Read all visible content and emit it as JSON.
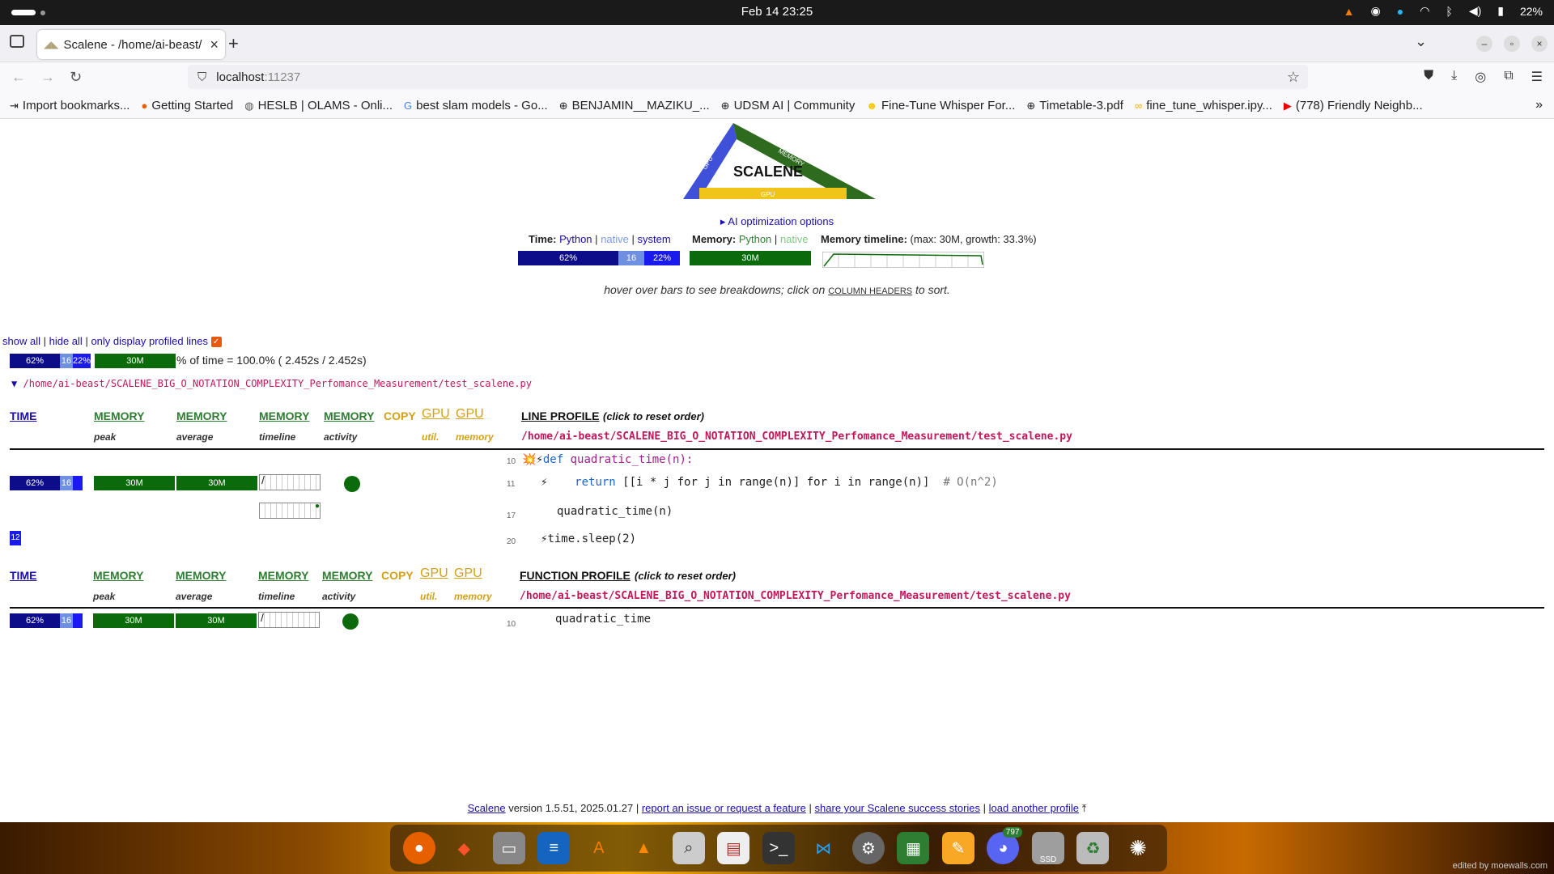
{
  "system": {
    "clock": "Feb 14  23:25",
    "battery": "22%"
  },
  "browser": {
    "tab_title": "Scalene - /home/ai-beast/",
    "url_host": "localhost",
    "url_port": ":11237",
    "bookmarks": [
      {
        "label": "Import bookmarks...",
        "icon": "import-icon"
      },
      {
        "label": "Getting Started",
        "icon": "firefox-icon"
      },
      {
        "label": "HESLB | OLAMS - Onli...",
        "icon": "heslb-icon"
      },
      {
        "label": "best slam models - Go...",
        "icon": "google-icon"
      },
      {
        "label": "BENJAMIN__MAZIKU_...",
        "icon": "globe-icon"
      },
      {
        "label": "UDSM AI | Community",
        "icon": "globe-icon"
      },
      {
        "label": "Fine-Tune Whisper For...",
        "icon": "hf-icon"
      },
      {
        "label": "Timetable-3.pdf",
        "icon": "globe-icon"
      },
      {
        "label": "fine_tune_whisper.ipy...",
        "icon": "colab-icon"
      },
      {
        "label": "(778) Friendly Neighb...",
        "icon": "youtube-icon"
      }
    ]
  },
  "scalene": {
    "logo_text": "SCALENE",
    "logo_gpu_left": "GPU",
    "logo_memory": "MEMORY",
    "logo_gpu_bottom": "GPU",
    "ai_options": "▸ AI optimization options",
    "time_label": "Time:",
    "time_python": "Python",
    "time_native": "native",
    "time_system": "system",
    "sep": "|",
    "memory_label": "Memory:",
    "memory_python": "Python",
    "memory_native": "native",
    "memtimeline_label": "Memory timeline:",
    "memtimeline_detail": "(max: 30M, growth: 33.3%)",
    "bar_python_pct": "62%",
    "bar_native_pct": "16",
    "bar_system_pct": "22%",
    "bar_memory": "30M",
    "time_python_frac": 0.62,
    "time_native_frac": 0.16,
    "time_system_frac": 0.22,
    "hint_pre": "hover over bars to see breakdowns; click on",
    "hint_headers": "COLUMN HEADERS",
    "hint_post": "to sort.",
    "show_all": "show all",
    "hide_all": "hide all",
    "only_profiled": "only display profiled lines",
    "check_mark": "✓",
    "summary_pct_text": "% of time = 100.0% ( 2.452s / 2.452s)",
    "summary_python": "62%",
    "summary_native": "16",
    "summary_system": "22%",
    "summary_mem": "30M",
    "file_toggle": "▼",
    "file_path": "/home/ai-beast/SCALENE_BIG_O_NOTATION_COMPLEXITY_Perfomance_Measurement/test_scalene.py",
    "headers": {
      "time": "TIME",
      "memory": "MEMORY",
      "copy": "COPY",
      "gpu": "GPU",
      "peak": "peak",
      "average": "average",
      "timeline": "timeline",
      "activity": "activity",
      "util": "util.",
      "gpu_memory": "memory",
      "line_profile": "LINE PROFILE",
      "function_profile": "FUNCTION PROFILE",
      "reset_order": "(click to reset order)"
    },
    "line_rows": [
      {
        "lineno": "10",
        "prefix": "💥⚡",
        "code_kw": "def",
        "code_rest": " quadratic_time(n):"
      },
      {
        "lineno": "11",
        "prefix": "⚡",
        "code_kw": "return",
        "code_rest": " [[i * j for j in range(n)] for i in range(n)]",
        "comment": "  # O(n^2)",
        "time_python": "62%",
        "time_native": "16",
        "mem_peak": "30M",
        "mem_avg": "30M"
      },
      {
        "lineno": "17",
        "prefix": "",
        "code_kw": "",
        "code_rest": "quadratic_time(n)"
      },
      {
        "lineno": "20",
        "prefix": "⚡",
        "code_kw": "",
        "code_rest": "time.sleep(2)",
        "time_system": "12"
      }
    ],
    "function_rows": [
      {
        "lineno": "10",
        "name": "quadratic_time",
        "time_python": "62%",
        "time_native": "16",
        "mem_peak": "30M",
        "mem_avg": "30M"
      }
    ]
  },
  "footer": {
    "scalene_link": "Scalene",
    "version": "version 1.5.51, 2025.01.27",
    "report_link": "report an issue or request a feature",
    "share_link": "share your Scalene success stories",
    "load_link": "load another profile",
    "sep": "|"
  },
  "dock": {
    "apps": [
      "firefox-icon",
      "brave-icon",
      "files-icon",
      "writer-icon",
      "appcenter-icon",
      "vlc-icon",
      "search-icon",
      "document-viewer-icon",
      "terminal-icon",
      "vscode-icon",
      "settings-icon",
      "calc-icon",
      "text-editor-icon",
      "discord-icon",
      "ssd-icon",
      "trash-icon",
      "ubuntu-icon"
    ],
    "discord_badge": "797",
    "ssd_label": "SSD",
    "credit": "edited by moewalls.com"
  }
}
